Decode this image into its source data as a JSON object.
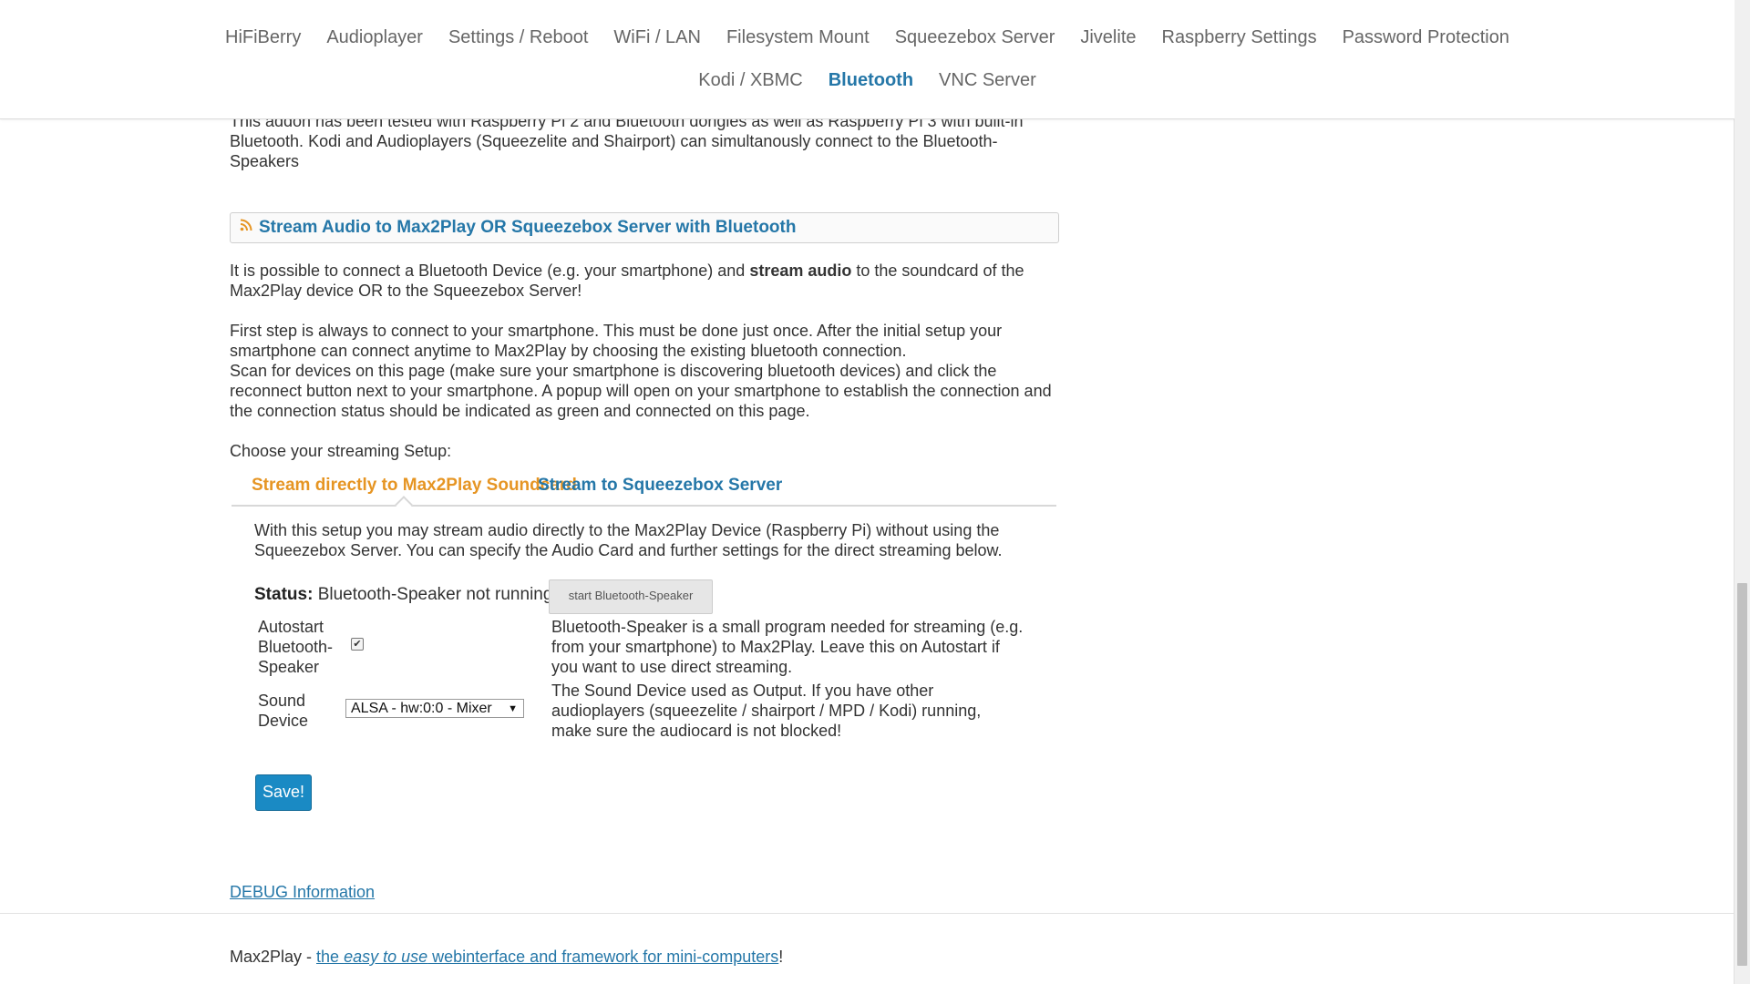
{
  "nav": {
    "row1": [
      "HiFiBerry",
      "Audioplayer",
      "Settings / Reboot",
      "WiFi / LAN",
      "Filesystem Mount",
      "Squeezebox Server",
      "Jivelite",
      "Raspberry Settings",
      "Password Protection"
    ],
    "row2": [
      "Kodi / XBMC",
      "Bluetooth",
      "VNC Server"
    ],
    "active": "Bluetooth"
  },
  "intro": "This addon has been tested with Raspberry Pi 2 and Bluetooth dongles as well as Raspberry Pi 3 with built-in Bluetooth. Kodi and Audioplayers (Squeezelite and Shairport) can simultanously connect to the Bluetooth-Speakers",
  "section": {
    "title": "Stream Audio to Max2Play OR Squeezebox Server with Bluetooth",
    "p1_a": "It is possible to connect a Bluetooth Device (e.g. your smartphone) and ",
    "p1_bold": "stream audio",
    "p1_b": " to the soundcard of the Max2Play device OR to the Squeezebox Server!",
    "p2": "First step is always to connect to your smartphone. This must be done just once. After the initial setup your smartphone can connect anytime to Max2Play by choosing the existing bluetooth connection.",
    "p2b": "Scan for devices on this page (make sure your smartphone is discovering bluetooth devices) and click the reconnect button next to your smartphone. A popup will open on your smartphone to establish the connection and the connection status should be indicated as green and connected on this page.",
    "p3": "Choose your streaming Setup:"
  },
  "tabs": [
    "Stream directly to Max2Play Soundcard",
    "Stream to Squeezebox Server"
  ],
  "tab_content": {
    "description": "With this setup you may stream audio directly to the Max2Play Device (Raspberry Pi) without using the Squeezebox Server. You can specify the Audio Card and further settings for the direct streaming below.",
    "status_label": "Status:",
    "status_value": "Bluetooth-Speaker not running",
    "start_button": "start Bluetooth-Speaker",
    "autostart_label": "Autostart Bluetooth-Speaker",
    "autostart_checked": true,
    "autostart_help": "Bluetooth-Speaker is a small program needed for streaming (e.g. from your smartphone) to Max2Play. Leave this on Autostart if you want to use direct streaming.",
    "sound_label": "Sound Device",
    "sound_value": "ALSA - hw:0:0 - Mixer",
    "sound_help": "The Sound Device used as Output. If you have other audioplayers (squeezelite / shairport / MPD / Kodi) running, make sure the audiocard is not blocked!",
    "save_button": "Save!"
  },
  "debug_link": "DEBUG Information",
  "footer": {
    "prefix": "Max2Play - ",
    "link_a": "the ",
    "link_em": "easy to use",
    "link_b": " webinterface and framework for mini-computers",
    "suffix": "!"
  },
  "colors": {
    "link": "#2577a8",
    "active_tab": "#e69523",
    "save_button": "#1a8ac4"
  }
}
